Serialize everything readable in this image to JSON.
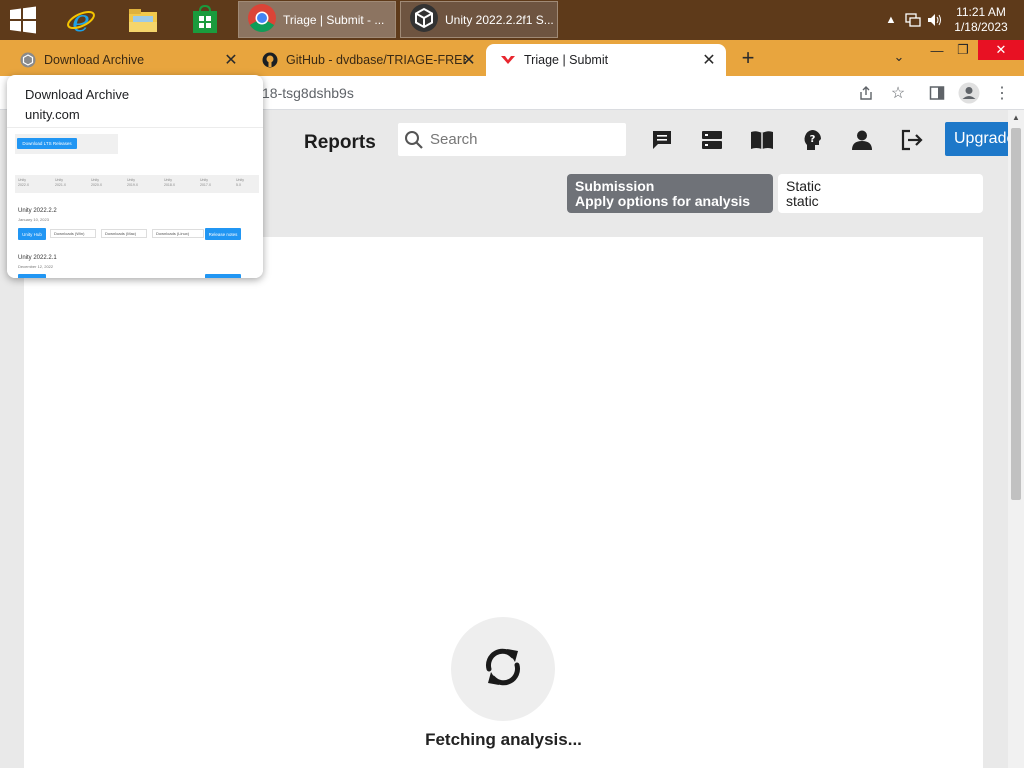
{
  "taskbar": {
    "tasks": [
      {
        "label": "Triage | Submit - ...",
        "icon": "chrome-icon"
      },
      {
        "label": "Unity 2022.2.2f1 S...",
        "icon": "unity-icon"
      }
    ],
    "clock": {
      "time": "11:21 AM",
      "date": "1/18/2023"
    },
    "colors": {
      "background": "#5e3a1a"
    }
  },
  "browser": {
    "tabs": [
      {
        "title": "Download Archive",
        "favicon": "unity-favicon"
      },
      {
        "title": "GitHub - dvdbase/TRIAGE-FREE-",
        "favicon": "github-favicon"
      },
      {
        "title": "Triage | Submit",
        "favicon": "triage-favicon",
        "active": true
      }
    ],
    "url_fragment": "18-tsg8dshb9s",
    "colors": {
      "tabstrip": "#e8a53e",
      "close_button": "#e81123"
    }
  },
  "hover_card": {
    "title": "Download Archive",
    "domain": "unity.com",
    "thumbnail": {
      "button_label": "Download LTS Releases",
      "version_tabs": [
        {
          "name": "Unity",
          "ver": "2022.X"
        },
        {
          "name": "Unity",
          "ver": "2021.X"
        },
        {
          "name": "Unity",
          "ver": "2020.X"
        },
        {
          "name": "Unity",
          "ver": "2019.X"
        },
        {
          "name": "Unity",
          "ver": "2018.X"
        },
        {
          "name": "Unity",
          "ver": "2017.X"
        },
        {
          "name": "Unity",
          "ver": "5.X"
        }
      ],
      "releases": [
        {
          "name": "Unity 2022.2.2",
          "date": "January 10, 2023"
        },
        {
          "name": "Unity 2022.2.1",
          "date": "December 12, 2022"
        }
      ],
      "row_buttons": {
        "unity_hub": "Unity Hub",
        "downloads_win": "Downloads (Win)",
        "downloads_mac": "Downloads (Mac)",
        "downloads_linux": "Downloads (Linux)",
        "release_notes": "Release notes"
      }
    }
  },
  "page": {
    "reports_label": "Reports",
    "search_placeholder": "Search",
    "upgrade_label": "Upgrade",
    "submission": {
      "title": "Submission",
      "subtitle": "Apply options for analysis"
    },
    "static": {
      "title": "Static",
      "subtitle": "static"
    },
    "fetching_text": "Fetching analysis...",
    "colors": {
      "accent": "#1d78c9",
      "segment_active": "#6f7278"
    }
  }
}
